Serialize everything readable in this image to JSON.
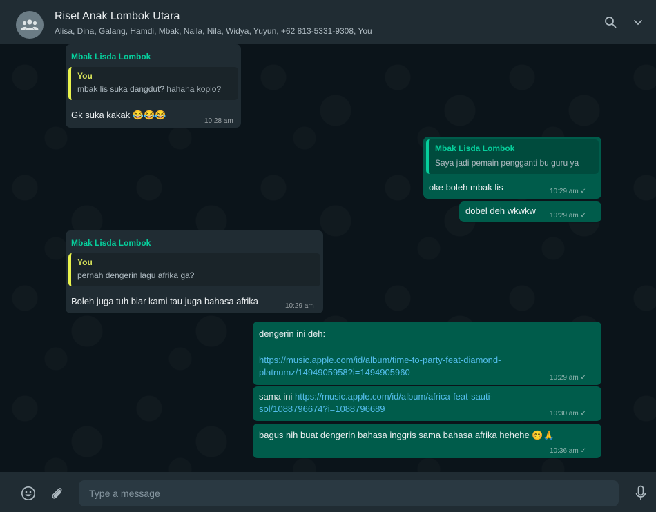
{
  "header": {
    "title": "Riset Anak Lombok Utara",
    "members": "Alisa, Dina, Galang, Hamdi, Mbak, Naila, Nila, Widya, Yuyun, +62 813-5331-9308, You",
    "icons": [
      "group-avatar-icon",
      "search-icon",
      "chevron-down-icon"
    ]
  },
  "messages": [
    {
      "direction": "incoming",
      "sender": "Mbak Lisda Lombok",
      "quote": {
        "name": "You",
        "text": "mbak lis suka dangdut? hahaha koplo?"
      },
      "text": "Gk suka kakak 😂😂😂",
      "time": "10:28 am"
    },
    {
      "direction": "outgoing",
      "quote": {
        "name": "Mbak Lisda Lombok",
        "text": "Saya jadi pemain pengganti bu guru ya"
      },
      "text": "oke boleh mbak lis",
      "time": "10:29 am"
    },
    {
      "direction": "outgoing",
      "text": "dobel deh wkwkw",
      "time": "10:29 am"
    },
    {
      "direction": "incoming",
      "sender": "Mbak Lisda Lombok",
      "quote": {
        "name": "You",
        "text": "pernah dengerin lagu afrika ga?"
      },
      "text": "Boleh juga tuh biar kami tau juga bahasa afrika",
      "time": "10:29 am"
    },
    {
      "direction": "outgoing",
      "text": "dengerin ini deh:",
      "link_line1": "https://music.apple.com/id/album/time-to-party-feat-diamond-",
      "link_line2": "platnumz/1494905958?i=1494905960",
      "time": "10:29 am"
    },
    {
      "direction": "outgoing",
      "text": "sama ini ",
      "link_line1": "https://music.apple.com/id/album/africa-feat-sauti-",
      "link_line2": "sol/1088796674?i=1088796689",
      "time": "10:30 am"
    },
    {
      "direction": "outgoing",
      "text": "bagus nih buat dengerin bahasa inggris sama bahasa afrika hehehe 😊🙏",
      "time": "10:36 am"
    }
  ],
  "tick": "✓",
  "composer": {
    "placeholder": "Type a message",
    "icons": [
      "emoji-icon",
      "attach-icon",
      "microphone-icon"
    ]
  },
  "colors": {
    "header_bg": "#202c33",
    "chat_bg": "#0b141a",
    "incoming_bubble": "#202c33",
    "outgoing_bubble": "#005c4b",
    "sender_name": "#06cf9c",
    "link": "#53bdeb"
  }
}
